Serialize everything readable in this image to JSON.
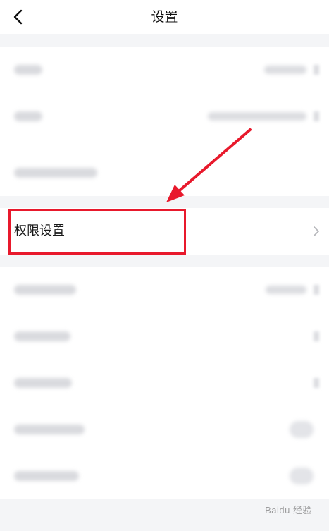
{
  "nav": {
    "title": "设置",
    "back_icon": "chevron-left-icon"
  },
  "permission_row": {
    "label": "权限设置",
    "chevron_icon": "chevron-right-icon"
  },
  "colors": {
    "highlight": "#e8192c",
    "background": "#f4f5f7",
    "row_background": "#ffffff"
  },
  "watermark": {
    "text": "Baidu 经验"
  }
}
